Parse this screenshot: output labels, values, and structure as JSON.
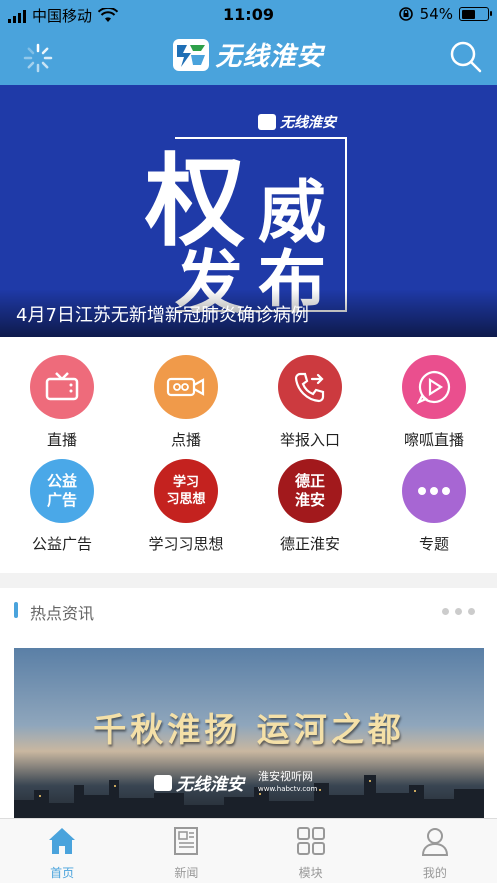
{
  "status_bar": {
    "carrier": "中国移动",
    "time": "11:09",
    "battery": "54%",
    "battery_level": 0.54
  },
  "nav": {
    "app_title": "无线淮安"
  },
  "banner": {
    "big_char_1": "权",
    "big_char_2": "威",
    "big_char_3": "发",
    "big_char_4": "布",
    "mini_logo": "无线淮安",
    "caption": "4月7日江苏无新增新冠肺炎确诊病例"
  },
  "features": [
    {
      "label": "直播",
      "icon": "tv-icon",
      "color": "#ee6b7b"
    },
    {
      "label": "点播",
      "icon": "video-camera-icon",
      "color": "#f09a4a"
    },
    {
      "label": "举报入口",
      "icon": "phone-forward-icon",
      "color": "#cc3a3f"
    },
    {
      "label": "嚓呱直播",
      "icon": "play-icon",
      "color": "#ea4f8e"
    },
    {
      "label": "公益广告",
      "icon_text": "公益\n广告",
      "color": "#4aa8e8"
    },
    {
      "label": "学习习思想",
      "icon_text": "学习\n习思想",
      "color": "#c4221f"
    },
    {
      "label": "德正淮安",
      "icon_text": "德正\n淮安",
      "color": "#a2191c"
    },
    {
      "label": "专题",
      "icon": "more-dots-icon",
      "color": "#a766d3"
    }
  ],
  "hot": {
    "title": "热点资讯"
  },
  "news": {
    "headline": "千秋淮扬 运河之都",
    "logo_a": "无线淮安",
    "logo_b": "淮安视听网",
    "logo_b_url": "www.habctv.com"
  },
  "tabs": [
    {
      "label": "首页",
      "icon": "home-icon",
      "active": true
    },
    {
      "label": "新闻",
      "icon": "newspaper-icon",
      "active": false
    },
    {
      "label": "模块",
      "icon": "grid-icon",
      "active": false
    },
    {
      "label": "我的",
      "icon": "user-icon",
      "active": false
    }
  ],
  "colors": {
    "brand": "#4aa3dc",
    "banner_bg": "#1f3aa8"
  }
}
